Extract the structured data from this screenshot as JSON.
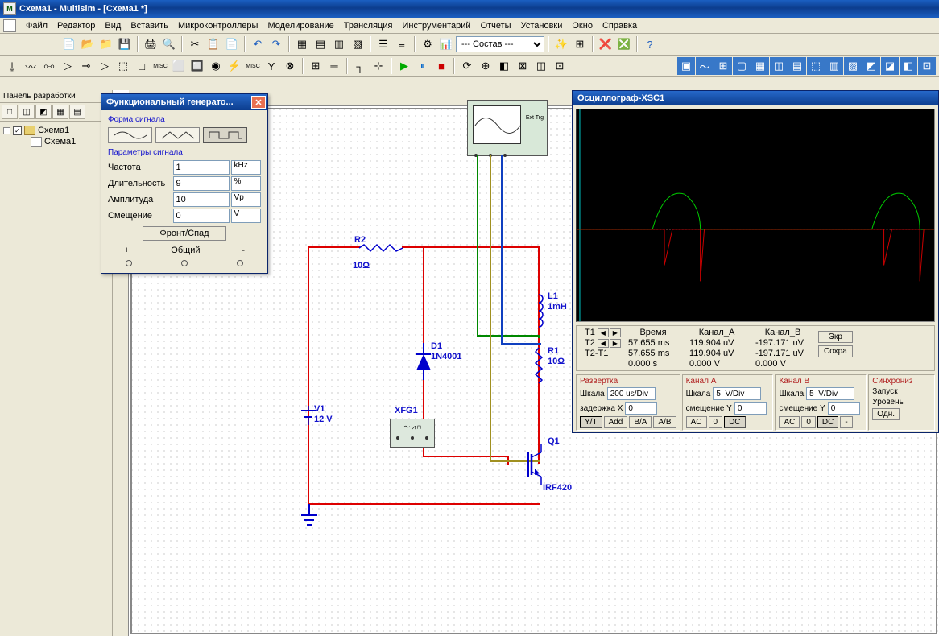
{
  "title": "Схема1  -  Multisim  -  [Схема1 *]",
  "menu": [
    "Файл",
    "Редактор",
    "Вид",
    "Вставить",
    "Микроконтроллеры",
    "Моделирование",
    "Трансляция",
    "Инструментарий",
    "Отчеты",
    "Установки",
    "Окно",
    "Справка"
  ],
  "toolbar_combo": "--- Состав ---",
  "design_panel": {
    "title": "Панель разработки",
    "root": "Схема1",
    "child": "Схема1"
  },
  "func_gen": {
    "title": "Функциональный генерато...",
    "signal_shape_label": "Форма сигнала",
    "params_label": "Параметры сигнала",
    "rows": {
      "freq": {
        "label": "Частота",
        "value": "1",
        "unit": "kHz"
      },
      "duty": {
        "label": "Длительность",
        "value": "9",
        "unit": "%"
      },
      "amp": {
        "label": "Амплитуда",
        "value": "10",
        "unit": "Vp"
      },
      "offset": {
        "label": "Смещение",
        "value": "0",
        "unit": "V"
      }
    },
    "button": "Фронт/Спад",
    "common": "Общий",
    "plus": "+",
    "minus": "-"
  },
  "osc": {
    "title": "Осциллограф-XSC1",
    "t1_label": "T1",
    "t2_label": "T2",
    "tdiff_label": "T2-T1",
    "time_header": "Время",
    "cha_header": "Канал_А",
    "chb_header": "Канал_В",
    "t1_time": "57.655 ms",
    "t1_a": "119.904 uV",
    "t1_b": "-197.171 uV",
    "t2_time": "57.655 ms",
    "t2_a": "119.904 uV",
    "t2_b": "-197.171 uV",
    "td_time": "0.000 s",
    "td_a": "0.000 V",
    "td_b": "0.000 V",
    "reverse_btn": "Экр",
    "save_btn": "Сохра",
    "timebase": {
      "title": "Развертка",
      "scale_label": "Шкала",
      "scale": "200 us/Div",
      "xpos_label": "задержка Х",
      "xpos": "0",
      "buttons": [
        "Y/T",
        "Add",
        "B/A",
        "A/B"
      ]
    },
    "channel_a": {
      "title": "Канал A",
      "scale_label": "Шкала",
      "scale": "5  V/Div",
      "ypos_label": "смещение Y",
      "ypos": "0",
      "buttons": [
        "AC",
        "0",
        "DC"
      ]
    },
    "channel_b": {
      "title": "Канал B",
      "scale_label": "Шкала",
      "scale": "5  V/Div",
      "ypos_label": "смещение Y",
      "ypos": "0",
      "buttons": [
        "AC",
        "0",
        "DC",
        "-"
      ]
    },
    "trigger": {
      "title": "Синхрониз",
      "launch_label": "Запуск",
      "level_label": "Уровень",
      "button": "Одн."
    }
  },
  "schematic": {
    "xsc1_ext": "Ext Trg",
    "r2": {
      "name": "R2",
      "value": "10Ω"
    },
    "r1": {
      "name": "R1",
      "value": "10Ω"
    },
    "l1": {
      "name": "L1",
      "value": "1mH"
    },
    "d1": {
      "name": "D1",
      "value": "1N4001"
    },
    "v1": {
      "name": "V1",
      "value": "12 V"
    },
    "q1": {
      "name": "Q1",
      "value": "IRF420"
    },
    "xfg1": "XFG1"
  }
}
